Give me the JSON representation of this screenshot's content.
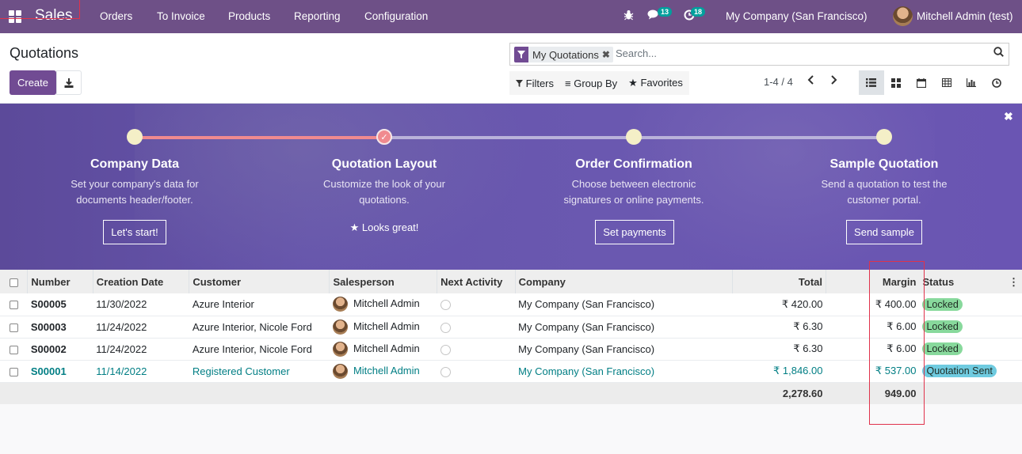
{
  "navbar": {
    "app_name": "Sales",
    "menu": [
      "Orders",
      "To Invoice",
      "Products",
      "Reporting",
      "Configuration"
    ],
    "messages_badge": "13",
    "activity_badge": "18",
    "company": "My Company (San Francisco)",
    "user": "Mitchell Admin (test)"
  },
  "control_panel": {
    "title": "Quotations",
    "create_label": "Create",
    "search_facet": "My Quotations",
    "search_placeholder": "Search...",
    "filters_label": "Filters",
    "group_by_label": "Group By",
    "favorites_label": "Favorites",
    "pager": "1-4 / 4"
  },
  "banner": {
    "steps": [
      {
        "title": "Company Data",
        "desc1": "Set your company's data for",
        "desc2": "documents header/footer.",
        "button": "Let's start!"
      },
      {
        "title": "Quotation Layout",
        "desc1": "Customize the look of your",
        "desc2": "quotations.",
        "done": "Looks great!"
      },
      {
        "title": "Order Confirmation",
        "desc1": "Choose between electronic",
        "desc2": "signatures or online payments.",
        "button": "Set payments"
      },
      {
        "title": "Sample Quotation",
        "desc1": "Send a quotation to test the",
        "desc2": "customer portal.",
        "button": "Send sample"
      }
    ]
  },
  "table": {
    "headers": {
      "number": "Number",
      "creation_date": "Creation Date",
      "customer": "Customer",
      "salesperson": "Salesperson",
      "next_activity": "Next Activity",
      "company": "Company",
      "total": "Total",
      "margin": "Margin",
      "status": "Status"
    },
    "rows": [
      {
        "number": "S00005",
        "date": "11/30/2022",
        "customer": "Azure Interior",
        "salesperson": "Mitchell Admin",
        "company": "My Company (San Francisco)",
        "total": "₹ 420.00",
        "margin": "₹ 400.00",
        "status": "Locked"
      },
      {
        "number": "S00003",
        "date": "11/24/2022",
        "customer": "Azure Interior, Nicole Ford",
        "salesperson": "Mitchell Admin",
        "company": "My Company (San Francisco)",
        "total": "₹ 6.30",
        "margin": "₹ 6.00",
        "status": "Locked"
      },
      {
        "number": "S00002",
        "date": "11/24/2022",
        "customer": "Azure Interior, Nicole Ford",
        "salesperson": "Mitchell Admin",
        "company": "My Company (San Francisco)",
        "total": "₹ 6.30",
        "margin": "₹ 6.00",
        "status": "Locked"
      },
      {
        "number": "S00001",
        "date": "11/14/2022",
        "customer": "Registered Customer",
        "salesperson": "Mitchell Admin",
        "company": "My Company (San Francisco)",
        "total": "₹ 1,846.00",
        "margin": "₹ 537.00",
        "status": "Quotation Sent"
      }
    ],
    "footer": {
      "total": "2,278.60",
      "margin": "949.00"
    }
  },
  "colors": {
    "brand": "#714b93",
    "locked": "#88d99c",
    "sent": "#6fcbe0",
    "link": "#017e84",
    "highlight": "#e0324b"
  }
}
